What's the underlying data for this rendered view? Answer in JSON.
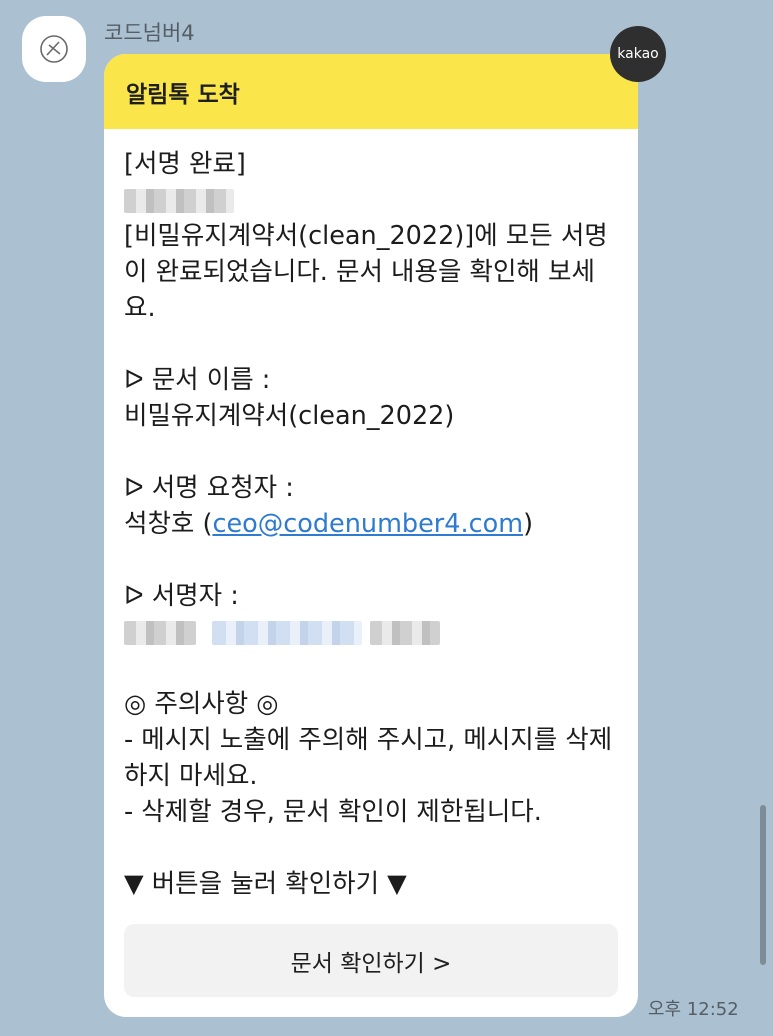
{
  "sender": {
    "name": "코드넘버4",
    "avatar_icon": "signature-icon"
  },
  "badge": {
    "label": "kakao",
    "color": "#2f2f2f"
  },
  "message": {
    "header_title": "알림톡 도착",
    "header_color": "#fae54b",
    "lines": {
      "title": "[서명 완료]",
      "intro": "[비밀유지계약서(clean_2022)]에 모든 서명이 완료되었습니다. 문서 내용을 확인해 보세요.",
      "doc_name_label": "ᐅ 문서 이름 :",
      "doc_name_value": "비밀유지계약서(clean_2022)",
      "requester_label": "ᐅ 서명 요청자 :",
      "requester_name": "석창호 (",
      "requester_email": "ceo@codenumber4.com",
      "requester_close": ")",
      "signer_label": "ᐅ 서명자 :",
      "notice_title": "◎ 주의사항 ◎",
      "notice_1": "- 메시지 노출에 주의해 주시고, 메시지를 삭제하지 마세요.",
      "notice_2": "- 삭제할 경우, 문서 확인이 제한됩니다.",
      "cta_hint": "▼ 버튼을 눌러 확인하기 ▼"
    },
    "button_label": "문서 확인하기 >",
    "link_color": "#2f7bd0"
  },
  "timestamp": "오후 12:52"
}
